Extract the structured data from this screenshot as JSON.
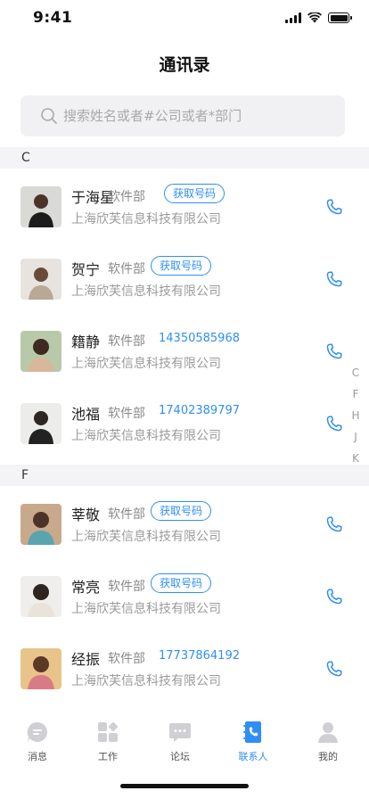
{
  "status": {
    "time": "9:41"
  },
  "header": {
    "title": "通讯录"
  },
  "search": {
    "placeholder": "搜索姓名或者#公司或者*部门"
  },
  "sections": [
    {
      "letter": "C",
      "contacts": [
        {
          "name": "于海星",
          "dept": "软件部",
          "phone_action": "获取号码",
          "company": "上海欣芙信息科技有限公司",
          "avatar": "avatar-man-1"
        },
        {
          "name": "贺宁",
          "dept": "软件部",
          "phone_action": "获取号码",
          "company": "上海欣芙信息科技有限公司",
          "avatar": "avatar-woman-1"
        },
        {
          "name": "籍静",
          "dept": "软件部",
          "phone": "14350585968",
          "company": "上海欣芙信息科技有限公司",
          "avatar": "avatar-woman-2"
        },
        {
          "name": "池福",
          "dept": "软件部",
          "phone": "17402389797",
          "company": "上海欣芙信息科技有限公司",
          "avatar": "avatar-man-2"
        }
      ]
    },
    {
      "letter": "F",
      "contacts": [
        {
          "name": "莘敬",
          "dept": "软件部",
          "phone_action": "获取号码",
          "company": "上海欣芙信息科技有限公司",
          "avatar": "avatar-woman-3"
        },
        {
          "name": "常亮",
          "dept": "软件部",
          "phone_action": "获取号码",
          "company": "上海欣芙信息科技有限公司",
          "avatar": "avatar-woman-4"
        },
        {
          "name": "经振",
          "dept": "软件部",
          "phone": "17737864192",
          "company": "上海欣芙信息科技有限公司",
          "avatar": "avatar-woman-5"
        }
      ]
    }
  ],
  "index_letters": [
    "C",
    "F",
    "H",
    "J",
    "K"
  ],
  "tabs": [
    {
      "label": "消息",
      "icon": "chat-bubble-icon",
      "active": false
    },
    {
      "label": "工作",
      "icon": "grid-apps-icon",
      "active": false
    },
    {
      "label": "论坛",
      "icon": "forum-icon",
      "active": false
    },
    {
      "label": "联系人",
      "icon": "contacts-book-icon",
      "active": true
    },
    {
      "label": "我的",
      "icon": "person-icon",
      "active": false
    }
  ],
  "colors": {
    "accent": "#2f8ef5",
    "section_bg": "#f4f4f6",
    "search_bg": "#f1f1f3",
    "tab_inactive": "#d0d0d4"
  }
}
